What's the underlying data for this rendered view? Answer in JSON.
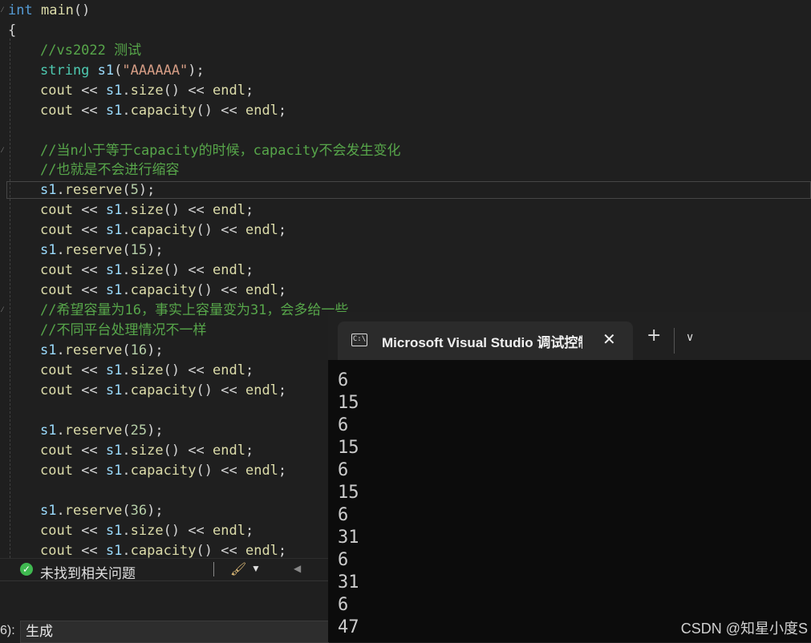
{
  "editor": {
    "header_line": {
      "kw": "int",
      "fn": "main",
      "rest": "()"
    },
    "open_brace": "{",
    "comment_vs": "//vs2022 测试",
    "decl": {
      "type": "string",
      "var": "s1",
      "open": "(",
      "str": "\"AAAAAA\"",
      "close": ");"
    },
    "comment_capacity_1": "//当n小于等于capacity的时候，capacity不会发生变化",
    "comment_capacity_2": "//也就是不会进行缩容",
    "comment_16_1": "//希望容量为16，事实上容量变为31，会多给一些",
    "comment_16_2": "//不同平台处理情况不一样",
    "reserve_calls": [
      "5",
      "15",
      "16",
      "25",
      "36"
    ],
    "tokens": {
      "cout": "cout",
      "shl": " << ",
      "s1": "s1",
      "dot": ".",
      "size": "size",
      "capacity": "capacity",
      "reserve": "reserve",
      "parens": "()",
      "endl": "endl",
      "semi": ";",
      "lparen": "(",
      "rparen_semi": ");"
    }
  },
  "status": {
    "issues_text": "未找到相关问题"
  },
  "output_panel": {
    "label": "6):",
    "source_value": "生成"
  },
  "terminal": {
    "tab_title": "Microsoft Visual Studio 调试控制台",
    "tab_icon_text": "C:\\",
    "output_lines": [
      "6",
      "15",
      "6",
      "15",
      "6",
      "15",
      "6",
      "31",
      "6",
      "31",
      "6",
      "47"
    ]
  },
  "watermark": "CSDN @知星小度S"
}
